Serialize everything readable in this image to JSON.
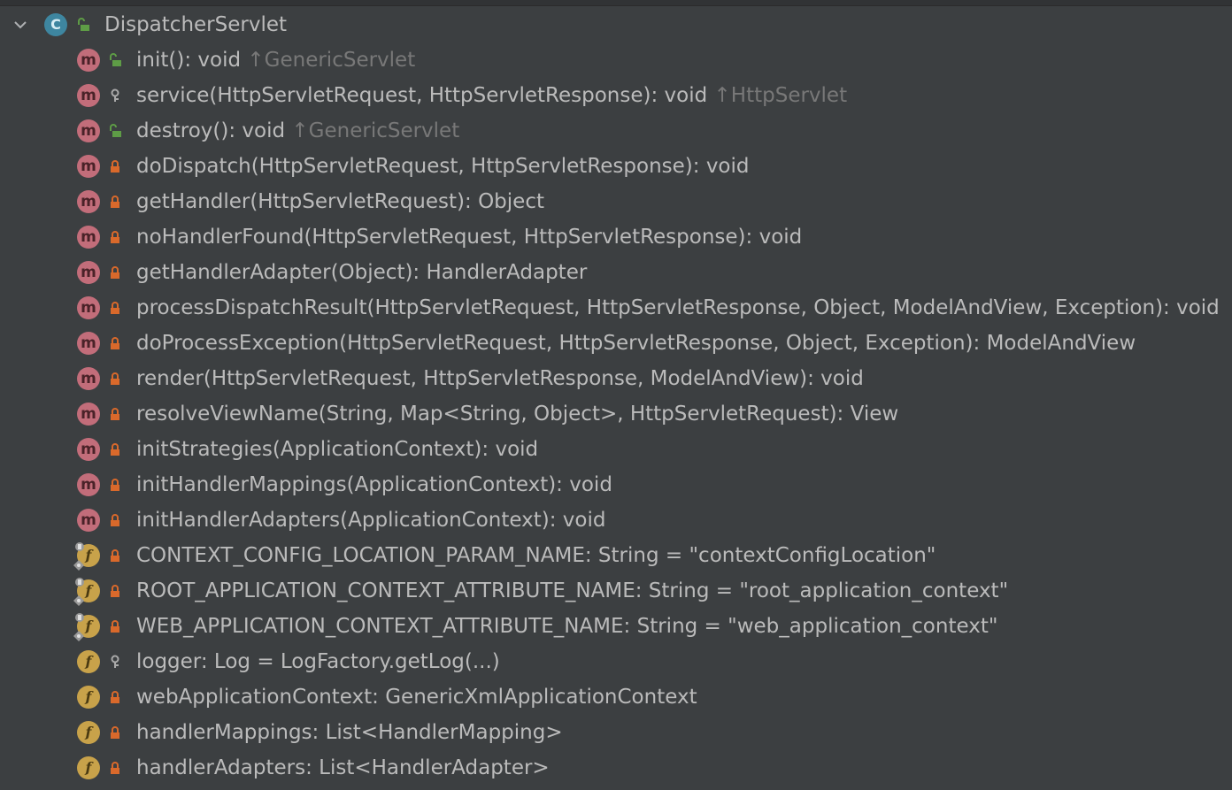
{
  "colors": {
    "background": "#3c3f41",
    "text": "#bbbbbb",
    "inherited_text": "#787878",
    "method_badge": "#c26d7a",
    "field_badge": "#c8a24a",
    "class_badge": "#3e86a0",
    "public_icon": "#5e9c46",
    "private_icon": "#d9692b",
    "protected_icon": "#a9a9a9"
  },
  "root": {
    "expanded": true,
    "kind": "class",
    "kind_letter": "C",
    "visibility": "public",
    "label": "DispatcherServlet"
  },
  "items": [
    {
      "kind": "method",
      "kind_letter": "m",
      "visibility": "public",
      "signature": "init(): void",
      "inherited": "↑GenericServlet"
    },
    {
      "kind": "method",
      "kind_letter": "m",
      "visibility": "protected",
      "signature": "service(HttpServletRequest, HttpServletResponse): void",
      "inherited": "↑HttpServlet"
    },
    {
      "kind": "method",
      "kind_letter": "m",
      "visibility": "public",
      "signature": "destroy(): void",
      "inherited": "↑GenericServlet"
    },
    {
      "kind": "method",
      "kind_letter": "m",
      "visibility": "private",
      "signature": "doDispatch(HttpServletRequest, HttpServletResponse): void",
      "inherited": ""
    },
    {
      "kind": "method",
      "kind_letter": "m",
      "visibility": "private",
      "signature": "getHandler(HttpServletRequest): Object",
      "inherited": ""
    },
    {
      "kind": "method",
      "kind_letter": "m",
      "visibility": "private",
      "signature": "noHandlerFound(HttpServletRequest, HttpServletResponse): void",
      "inherited": ""
    },
    {
      "kind": "method",
      "kind_letter": "m",
      "visibility": "private",
      "signature": "getHandlerAdapter(Object): HandlerAdapter",
      "inherited": ""
    },
    {
      "kind": "method",
      "kind_letter": "m",
      "visibility": "private",
      "signature": "processDispatchResult(HttpServletRequest, HttpServletResponse, Object, ModelAndView, Exception): void",
      "inherited": ""
    },
    {
      "kind": "method",
      "kind_letter": "m",
      "visibility": "private",
      "signature": "doProcessException(HttpServletRequest, HttpServletResponse, Object, Exception): ModelAndView",
      "inherited": ""
    },
    {
      "kind": "method",
      "kind_letter": "m",
      "visibility": "private",
      "signature": "render(HttpServletRequest, HttpServletResponse, ModelAndView): void",
      "inherited": ""
    },
    {
      "kind": "method",
      "kind_letter": "m",
      "visibility": "private",
      "signature": "resolveViewName(String, Map<String, Object>, HttpServletRequest): View",
      "inherited": ""
    },
    {
      "kind": "method",
      "kind_letter": "m",
      "visibility": "private",
      "signature": "initStrategies(ApplicationContext): void",
      "inherited": ""
    },
    {
      "kind": "method",
      "kind_letter": "m",
      "visibility": "private",
      "signature": "initHandlerMappings(ApplicationContext): void",
      "inherited": ""
    },
    {
      "kind": "method",
      "kind_letter": "m",
      "visibility": "private",
      "signature": "initHandlerAdapters(ApplicationContext): void",
      "inherited": ""
    },
    {
      "kind": "field",
      "kind_letter": "f",
      "static": true,
      "final": true,
      "visibility": "private",
      "signature": "CONTEXT_CONFIG_LOCATION_PARAM_NAME: String = \"contextConfigLocation\"",
      "inherited": ""
    },
    {
      "kind": "field",
      "kind_letter": "f",
      "static": true,
      "final": true,
      "visibility": "private",
      "signature": "ROOT_APPLICATION_CONTEXT_ATTRIBUTE_NAME: String = \"root_application_context\"",
      "inherited": ""
    },
    {
      "kind": "field",
      "kind_letter": "f",
      "static": true,
      "final": true,
      "visibility": "private",
      "signature": "WEB_APPLICATION_CONTEXT_ATTRIBUTE_NAME: String = \"web_application_context\"",
      "inherited": ""
    },
    {
      "kind": "field",
      "kind_letter": "f",
      "static": false,
      "final": true,
      "visibility": "protected",
      "signature": "logger: Log = LogFactory.getLog(...)",
      "inherited": ""
    },
    {
      "kind": "field",
      "kind_letter": "f",
      "static": false,
      "final": false,
      "visibility": "private",
      "signature": "webApplicationContext: GenericXmlApplicationContext",
      "inherited": ""
    },
    {
      "kind": "field",
      "kind_letter": "f",
      "static": false,
      "final": false,
      "visibility": "private",
      "signature": "handlerMappings: List<HandlerMapping>",
      "inherited": ""
    },
    {
      "kind": "field",
      "kind_letter": "f",
      "static": false,
      "final": false,
      "visibility": "private",
      "signature": "handlerAdapters: List<HandlerAdapter>",
      "inherited": ""
    }
  ]
}
